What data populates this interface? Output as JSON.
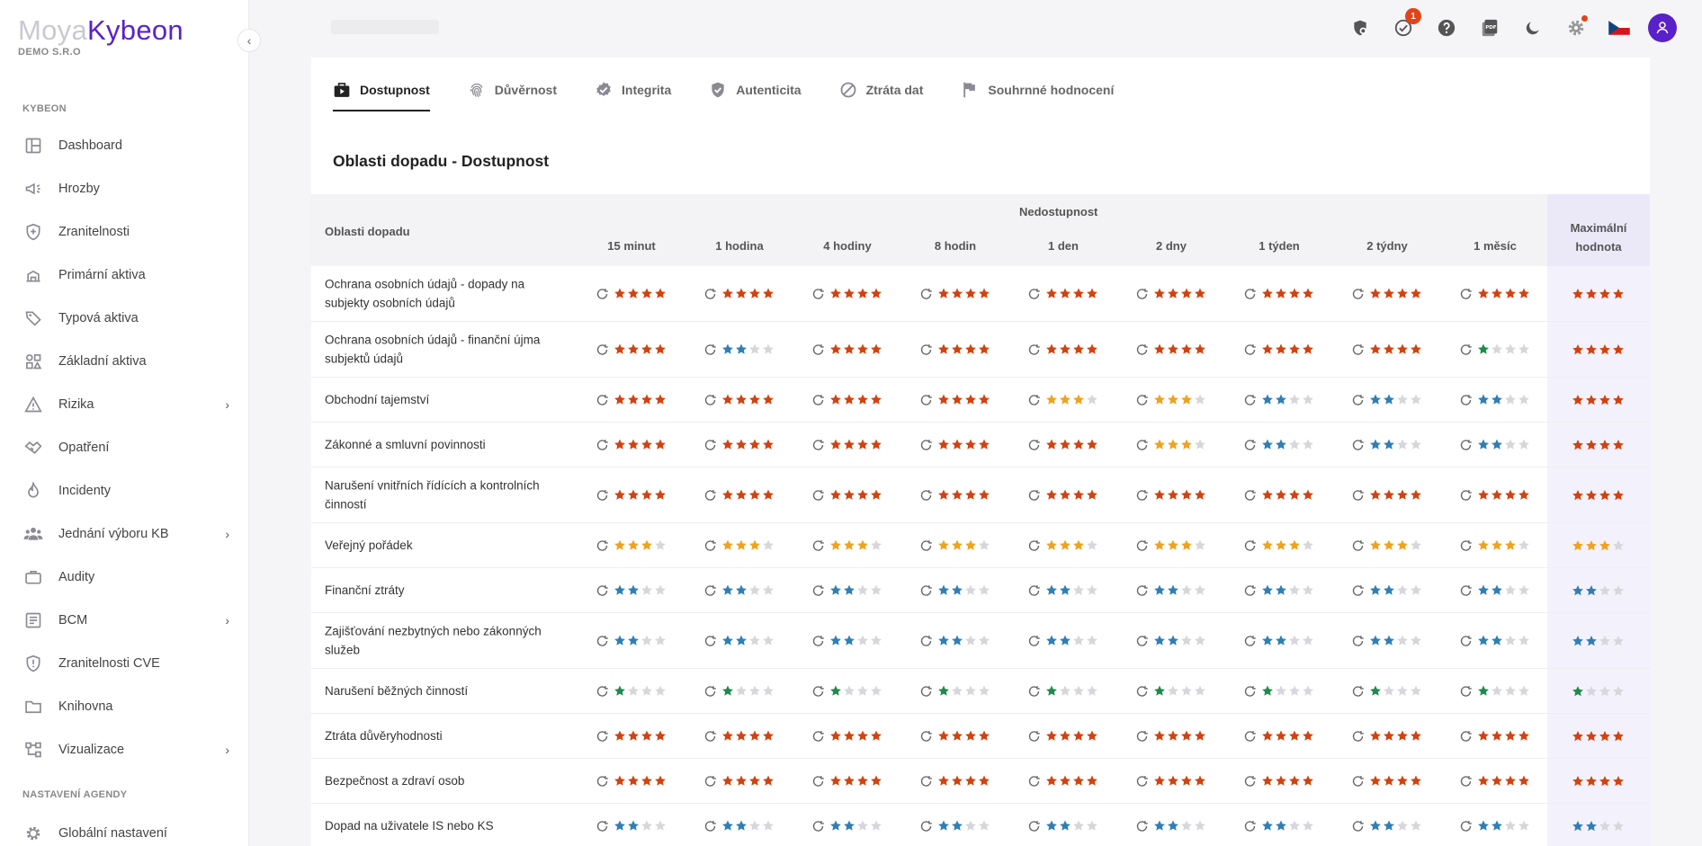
{
  "app": {
    "logo_part1": "Moya",
    "logo_part2": "Kybeon",
    "org": "DEMO S.R.O"
  },
  "sidebar": {
    "section1": "KYBEON",
    "section2": "NASTAVENÍ AGENDY",
    "items": [
      {
        "label": "Dashboard",
        "icon": "dashboard-icon",
        "chevron": false
      },
      {
        "label": "Hrozby",
        "icon": "megaphone-icon",
        "chevron": false
      },
      {
        "label": "Zranitelnosti",
        "icon": "shield-plus-icon",
        "chevron": false
      },
      {
        "label": "Primární aktiva",
        "icon": "primary-assets-icon",
        "chevron": false
      },
      {
        "label": "Typová aktiva",
        "icon": "tag-icon",
        "chevron": false
      },
      {
        "label": "Základní aktiva",
        "icon": "shapes-icon",
        "chevron": false
      },
      {
        "label": "Rizika",
        "icon": "warning-icon",
        "chevron": true
      },
      {
        "label": "Opatření",
        "icon": "handshake-icon",
        "chevron": false
      },
      {
        "label": "Incidenty",
        "icon": "fire-icon",
        "chevron": false
      },
      {
        "label": "Jednání výboru KB",
        "icon": "group-icon",
        "chevron": true
      },
      {
        "label": "Audity",
        "icon": "briefcase-icon",
        "chevron": false
      },
      {
        "label": "BCM",
        "icon": "bcm-icon",
        "chevron": true
      },
      {
        "label": "Zranitelnosti CVE",
        "icon": "shield-alert-icon",
        "chevron": false
      },
      {
        "label": "Knihovna",
        "icon": "folder-icon",
        "chevron": false
      },
      {
        "label": "Vizualizace",
        "icon": "hierarchy-icon",
        "chevron": true
      }
    ],
    "settings_items": [
      {
        "label": "Globální nastavení",
        "icon": "gear-icon"
      }
    ]
  },
  "topbar": {
    "notification_count": "1"
  },
  "tabs": [
    {
      "label": "Dostupnost",
      "icon": "briefcase-play-icon",
      "active": true
    },
    {
      "label": "Důvěrnost",
      "icon": "fingerprint-icon",
      "active": false
    },
    {
      "label": "Integrita",
      "icon": "badge-check-icon",
      "active": false
    },
    {
      "label": "Autenticita",
      "icon": "shield-check-icon",
      "active": false
    },
    {
      "label": "Ztráta dat",
      "icon": "block-icon",
      "active": false
    },
    {
      "label": "Souhrnné hodnocení",
      "icon": "flag-icon",
      "active": false
    }
  ],
  "page_title": "Oblasti dopadu - Dostupnost",
  "table": {
    "area_header": "Oblasti dopadu",
    "group_header": "Nedostupnost",
    "max_header_line1": "Maximální",
    "max_header_line2": "hodnota",
    "columns": [
      "15 minut",
      "1 hodina",
      "4 hodiny",
      "8 hodin",
      "1 den",
      "2 dny",
      "1 týden",
      "2 týdny",
      "1 měsíc"
    ],
    "rows": [
      {
        "name": "Ochrana osobních údajů - dopady na subjekty osobních údajů",
        "values": [
          4,
          4,
          4,
          4,
          4,
          4,
          4,
          4,
          4
        ],
        "max": 4
      },
      {
        "name": "Ochrana osobních údajů - finanční újma subjektů údajů",
        "values": [
          4,
          2,
          4,
          4,
          4,
          4,
          4,
          4,
          1
        ],
        "max": 4
      },
      {
        "name": "Obchodní tajemství",
        "values": [
          4,
          4,
          4,
          4,
          3,
          3,
          2,
          2,
          2
        ],
        "max": 4
      },
      {
        "name": "Zákonné a smluvní povinnosti",
        "values": [
          4,
          4,
          4,
          4,
          4,
          3,
          2,
          2,
          2
        ],
        "max": 4
      },
      {
        "name": "Narušení vnitřních řídících a kontrolních činností",
        "values": [
          4,
          4,
          4,
          4,
          4,
          4,
          4,
          4,
          4
        ],
        "max": 4
      },
      {
        "name": "Veřejný pořádek",
        "values": [
          3,
          3,
          3,
          3,
          3,
          3,
          3,
          3,
          3
        ],
        "max": 3
      },
      {
        "name": "Finanční ztráty",
        "values": [
          2,
          2,
          2,
          2,
          2,
          2,
          2,
          2,
          2
        ],
        "max": 2
      },
      {
        "name": "Zajišťování nezbytných nebo zákonných služeb",
        "values": [
          2,
          2,
          2,
          2,
          2,
          2,
          2,
          2,
          2
        ],
        "max": 2
      },
      {
        "name": "Narušení běžných činností",
        "values": [
          1,
          1,
          1,
          1,
          1,
          1,
          1,
          1,
          1
        ],
        "max": 1
      },
      {
        "name": "Ztráta důvěryhodnosti",
        "values": [
          4,
          4,
          4,
          4,
          4,
          4,
          4,
          4,
          4
        ],
        "max": 4
      },
      {
        "name": "Bezpečnost a zdraví osob",
        "values": [
          4,
          4,
          4,
          4,
          4,
          4,
          4,
          4,
          4
        ],
        "max": 4
      },
      {
        "name": "Dopad na uživatele IS nebo KS",
        "values": [
          2,
          2,
          2,
          2,
          2,
          2,
          2,
          2,
          2
        ],
        "max": 2
      }
    ]
  },
  "colors": {
    "level1": "#1e8a4c",
    "level2": "#2f7fb5",
    "level3": "#f0a21f",
    "level4": "#d2420f",
    "empty": "#d6d6db",
    "brand": "#5a21c9"
  }
}
